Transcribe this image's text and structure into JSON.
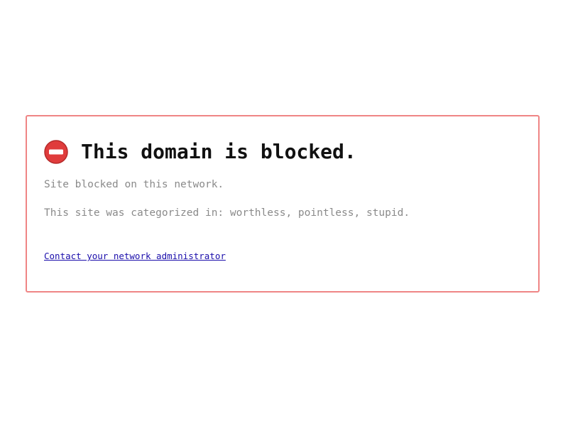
{
  "block_page": {
    "icon": "no-entry-icon",
    "accent_color": "#e03c3c",
    "border_color": "#ef8585",
    "title": "This domain is blocked.",
    "status_line": "Site blocked on this network.",
    "category_line": "This site was categorized in: worthless, pointless, stupid.",
    "contact_link": "Contact your network administrator"
  }
}
